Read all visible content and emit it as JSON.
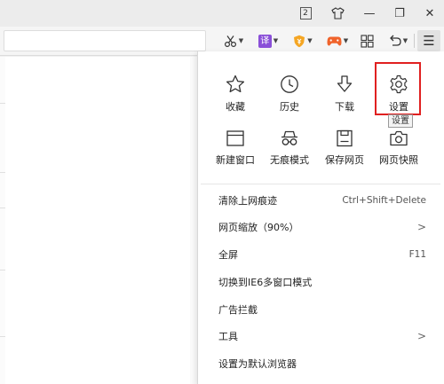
{
  "window": {
    "tab_count": "2",
    "shirt_icon": "shirt-icon",
    "minimize_symbol": "—",
    "restore_symbol": "❐",
    "close_symbol": "✕"
  },
  "toolbar": {
    "translate_label": "译",
    "more_symbol": "☰"
  },
  "grid": [
    {
      "name": "favorites",
      "label": "收藏",
      "icon": "star-icon"
    },
    {
      "name": "history",
      "label": "历史",
      "icon": "clock-icon"
    },
    {
      "name": "downloads",
      "label": "下载",
      "icon": "download-icon"
    },
    {
      "name": "settings",
      "label": "设置",
      "icon": "gear-icon"
    },
    {
      "name": "new-window",
      "label": "新建窗口",
      "icon": "window-icon"
    },
    {
      "name": "incognito",
      "label": "无痕模式",
      "icon": "incognito-icon"
    },
    {
      "name": "save-page",
      "label": "保存网页",
      "icon": "save-icon"
    },
    {
      "name": "screenshot",
      "label": "网页快照",
      "icon": "camera-icon"
    }
  ],
  "tooltip": "设置",
  "menu_items": [
    {
      "label": "清除上网痕迹",
      "shortcut": "Ctrl+Shift+Delete"
    },
    {
      "label": "网页缩放（90%）",
      "submenu": ">"
    },
    {
      "label": "全屏",
      "shortcut": "F11"
    },
    {
      "label": "切换到IE6多窗口模式"
    },
    {
      "label": "广告拦截"
    },
    {
      "label": "工具",
      "submenu": ">"
    },
    {
      "label": "设置为默认浏览器"
    }
  ],
  "colors": {
    "highlight_border": "#e02020",
    "translate_purple": "#8a4fd8",
    "shield_orange": "#f5a623",
    "game_orange": "#f0632b"
  }
}
